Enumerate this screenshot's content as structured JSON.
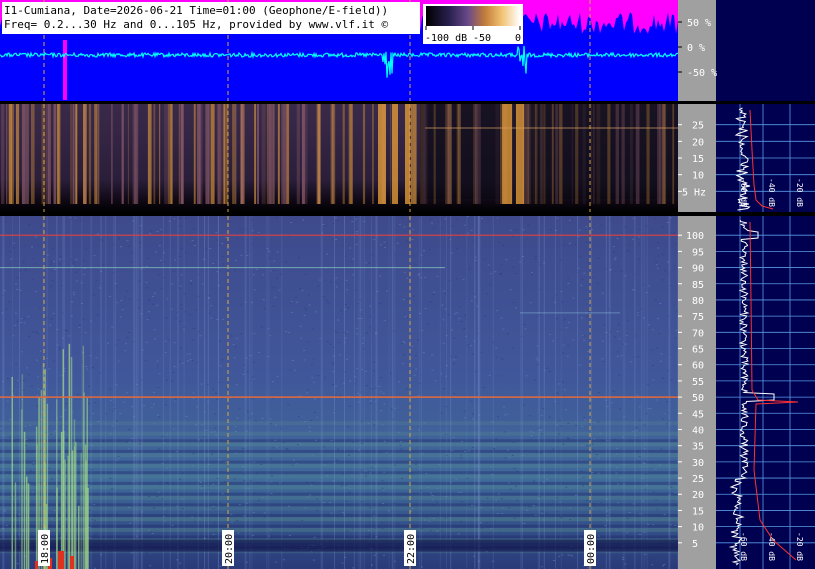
{
  "header": {
    "line1": "I1-Cumiana, Date=2026-06-21 Time=01:00 (Geophone/E-field))",
    "line2": "Freq= 0.2...30 Hz and 0...105 Hz, provided by www.vlf.it ©"
  },
  "colorbar": {
    "labels": [
      "-100 dB",
      "-50",
      "0"
    ]
  },
  "colors": {
    "background": "#000000",
    "amplitude_fill": "#0000ff",
    "amplitude_top": "#ff00ff",
    "amplitude_trace": "#00ffff",
    "axis_panel": "#000050",
    "gridline": "#5a9ae6",
    "time_marker": "#d9a640",
    "spectrum_trace": "#ffffff",
    "spectrum_fit": "#ff3030"
  },
  "chart_data": [
    {
      "type": "line",
      "panel": "amplitude",
      "y_ticks": [
        "50 %",
        "0 %",
        "-50 %"
      ],
      "y_values": [
        50,
        0,
        -50
      ],
      "ylim": [
        -100,
        100
      ]
    },
    {
      "type": "heatmap",
      "panel": "low-frequency spectrogram",
      "y_ticks": [
        "25",
        "20",
        "15",
        "10",
        "5 Hz"
      ],
      "y_values": [
        25,
        20,
        15,
        10,
        5
      ],
      "ylim": [
        0.2,
        30
      ],
      "spectrum_scale_labels": [
        "-60 dB",
        "-40 dB",
        "-20 dB"
      ]
    },
    {
      "type": "heatmap",
      "panel": "main spectrogram",
      "x_ticks": [
        "18:00",
        "20:00",
        "22:00",
        "00:00"
      ],
      "y_ticks": [
        "100",
        "95",
        "90",
        "85",
        "80",
        "75",
        "70",
        "65",
        "60",
        "55",
        "50",
        "45",
        "40",
        "35",
        "30",
        "25",
        "20",
        "15",
        "10",
        "5"
      ],
      "y_values": [
        100,
        95,
        90,
        85,
        80,
        75,
        70,
        65,
        60,
        55,
        50,
        45,
        40,
        35,
        30,
        25,
        20,
        15,
        10,
        5
      ],
      "ylim": [
        0,
        105
      ],
      "horizontal_lines_hz": [
        100,
        50
      ],
      "spectrum_scale_labels": [
        "-60 dB",
        "-40 dB",
        "-20 dB"
      ]
    }
  ]
}
